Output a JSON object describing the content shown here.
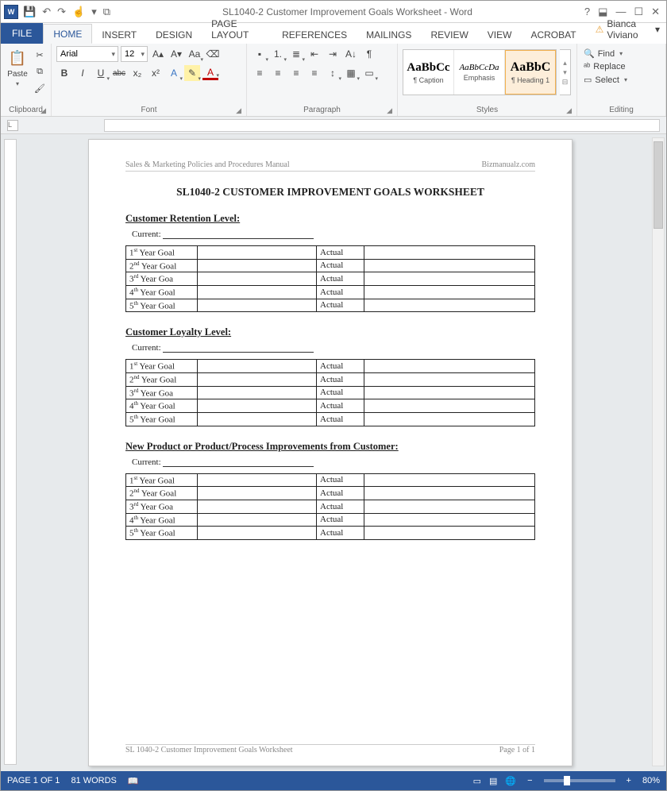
{
  "title_bar": {
    "app_icon_text": "W",
    "doc_title": "SL1040-2 Customer Improvement Goals Worksheet - Word",
    "qat": {
      "save": "💾",
      "undo": "↶",
      "redo": "↷",
      "more": "▾",
      "touch": "☝",
      "new": "⧉"
    },
    "win": {
      "help": "?",
      "ribbon": "⬓",
      "min": "—",
      "max": "☐",
      "close": "✕"
    }
  },
  "tabs": {
    "file": "FILE",
    "home": "HOME",
    "insert": "INSERT",
    "design": "DESIGN",
    "pagelayout": "PAGE LAYOUT",
    "references": "REFERENCES",
    "mailings": "MAILINGS",
    "review": "REVIEW",
    "view": "VIEW",
    "acrobat": "ACROBAT",
    "user": "Bianca Viviano"
  },
  "ribbon": {
    "clipboard": {
      "label": "Clipboard",
      "paste": "Paste",
      "paste_glyph": "📋",
      "cut": "✂",
      "copy": "⧉",
      "painter": "🖌"
    },
    "font": {
      "label": "Font",
      "name": "Arial",
      "size": "12",
      "grow": "A▴",
      "shrink": "A▾",
      "case": "Aa",
      "clear": "⌫",
      "bold": "B",
      "italic": "I",
      "underline": "U",
      "strike": "abc",
      "sub": "x₂",
      "sup": "x²",
      "effects": "A",
      "highlight": "✎",
      "color": "A"
    },
    "paragraph": {
      "label": "Paragraph",
      "bullets": "▪",
      "numbers": "1.",
      "multilevel": "≣",
      "dec_indent": "⇤",
      "inc_indent": "⇥",
      "sort": "A↓",
      "marks": "¶",
      "al": "≡",
      "ac": "≡",
      "ar": "≡",
      "aj": "≡",
      "spacing": "↕",
      "shading": "▦",
      "borders": "▭"
    },
    "styles": {
      "label": "Styles",
      "items": [
        {
          "preview": "AaBbCc",
          "name": "¶ Caption",
          "bold": true,
          "size": "15px"
        },
        {
          "preview": "AaBbCcDa",
          "name": "Emphasis",
          "italic": true,
          "size": "11px"
        },
        {
          "preview": "AaBbC",
          "name": "¶ Heading 1",
          "bold": true,
          "size": "16px"
        }
      ]
    },
    "editing": {
      "label": "Editing",
      "find": "Find",
      "replace": "Replace",
      "select": "Select",
      "find_glyph": "🔍",
      "replace_glyph": "ᵃᵇ",
      "select_glyph": "▭"
    }
  },
  "ruler": {
    "corner": "L"
  },
  "document": {
    "header_left": "Sales & Marketing Policies and Procedures Manual",
    "header_right": "Bizmanualz.com",
    "title": "SL1040-2 CUSTOMER IMPROVEMENT GOALS WORKSHEET",
    "current_label": "Current:",
    "actual_label": "Actual",
    "sections": [
      {
        "heading": "Customer Retention Level:",
        "rows": [
          "1st Year Goal",
          "2nd Year Goal",
          "3rd Year Goa",
          "4th Year Goal",
          "5th Year Goal"
        ]
      },
      {
        "heading": "Customer Loyalty Level:",
        "rows": [
          "1st Year Goal",
          "2nd Year Goal",
          "3rd Year Goa",
          "4th Year Goal",
          "5th Year Goal"
        ]
      },
      {
        "heading": "New Product or Product/Process Improvements from Customer:",
        "rows": [
          "1st Year Goal",
          "2nd Year Goal",
          "3rd Year Goa",
          "4th Year Goal",
          "5th Year Goal"
        ]
      }
    ],
    "footer_left": "SL 1040-2 Customer Improvement Goals Worksheet",
    "footer_right": "Page 1 of 1"
  },
  "status": {
    "page": "PAGE 1 OF 1",
    "words": "81 WORDS",
    "proof": "📖",
    "view_read": "▭",
    "view_print": "▤",
    "view_web": "🌐",
    "zoom_out": "−",
    "zoom_in": "+",
    "zoom_pct": "80%"
  }
}
